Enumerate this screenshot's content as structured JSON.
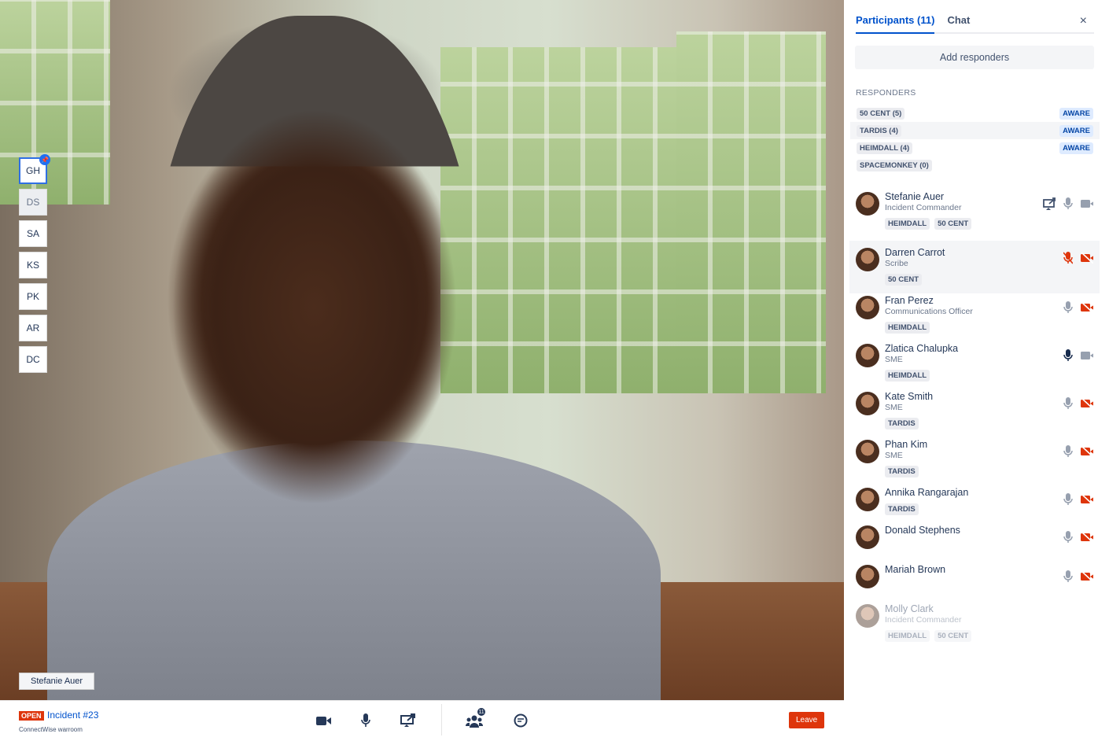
{
  "video": {
    "speaker_name": "Stefanie Auer",
    "thumbnails": [
      {
        "initials": "GH",
        "pinned": true,
        "active": true
      },
      {
        "initials": "DS",
        "dim": true
      },
      {
        "initials": "SA"
      },
      {
        "initials": "KS"
      },
      {
        "initials": "PK"
      },
      {
        "initials": "AR"
      },
      {
        "initials": "DC"
      }
    ]
  },
  "bottombar": {
    "status": "OPEN",
    "incident": "Incident #23",
    "workspace": "ConnectWise warroom",
    "participants_count": "11",
    "leave_label": "Leave"
  },
  "panel": {
    "tabs": [
      {
        "label": "Participants (11)",
        "selected": true
      },
      {
        "label": "Chat"
      }
    ],
    "close": "×",
    "add_responders": "Add responders",
    "responders_heading": "RESPONDERS",
    "groups": [
      {
        "name": "50 CENT (5)",
        "status": "AWARE"
      },
      {
        "name": "TARDIS (4)",
        "status": "AWARE"
      },
      {
        "name": "HEIMDALL (4)",
        "status": "AWARE"
      },
      {
        "name": "SPACEMONKEY (0)",
        "status": ""
      }
    ],
    "participants": [
      {
        "name": "Stefanie Auer",
        "role": "Incident Commander",
        "tags": [
          "HEIMDALL",
          "50 CENT"
        ],
        "screen": true,
        "mic": "on",
        "cam": "on"
      },
      {
        "name": "Darren Carrot",
        "role": "Scribe",
        "tags": [
          "50 CENT"
        ],
        "mic": "off",
        "cam": "off",
        "hover": true
      },
      {
        "name": "Fran Perez",
        "role": "Communications Officer",
        "tags": [
          "HEIMDALL"
        ],
        "mic": "on",
        "cam": "off"
      },
      {
        "name": "Zlatica Chalupka",
        "role": "SME",
        "tags": [
          "HEIMDALL"
        ],
        "mic": "speaking",
        "cam": "on"
      },
      {
        "name": "Kate Smith",
        "role": "SME",
        "tags": [
          "TARDIS"
        ],
        "mic": "on",
        "cam": "off"
      },
      {
        "name": "Phan Kim",
        "role": "SME",
        "tags": [
          "TARDIS"
        ],
        "mic": "on",
        "cam": "off"
      },
      {
        "name": "Annika Rangarajan",
        "role": "",
        "tags": [
          "TARDIS"
        ],
        "mic": "on",
        "cam": "off"
      },
      {
        "name": "Donald Stephens",
        "role": "",
        "tags": [],
        "mic": "on",
        "cam": "off"
      },
      {
        "name": "Mariah Brown",
        "role": "",
        "tags": [],
        "mic": "on",
        "cam": "off"
      },
      {
        "name": "Molly Clark",
        "role": "Incident Commander",
        "tags": [
          "HEIMDALL",
          "50 CENT"
        ],
        "faded": true
      }
    ]
  },
  "colors": {
    "accent": "#0052cc",
    "danger": "#de350b",
    "muted_icon": "#97a0af",
    "aware_bg": "#deebff"
  }
}
